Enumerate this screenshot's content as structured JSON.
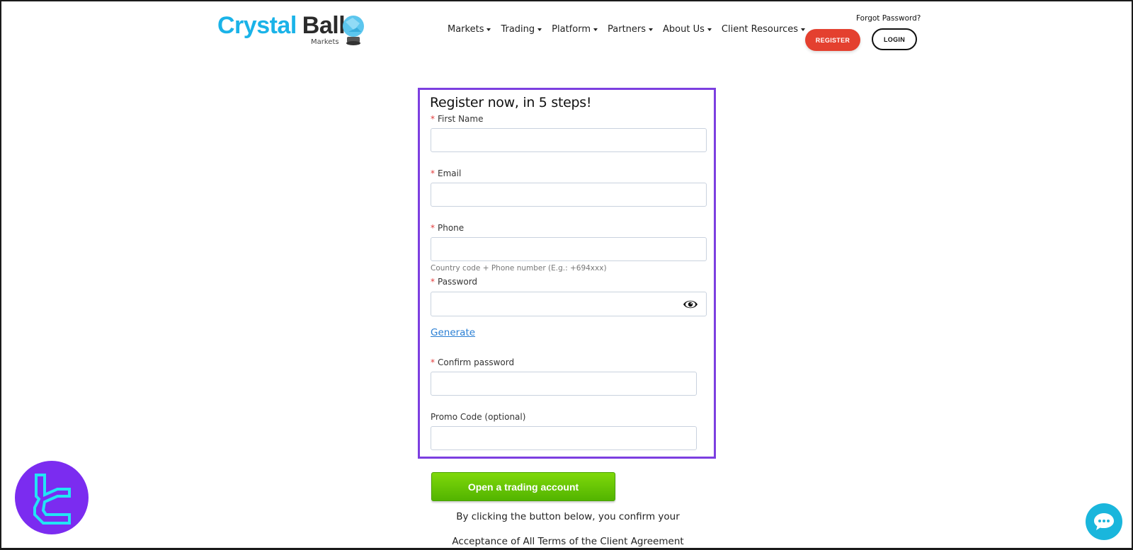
{
  "header": {
    "logo": {
      "brand_primary": "Crystal",
      "brand_secondary": "Ball",
      "subtitle": "Markets",
      "brand_color": "#1ab3e8"
    },
    "nav": [
      {
        "label": "Markets"
      },
      {
        "label": "Trading"
      },
      {
        "label": "Platform"
      },
      {
        "label": "Partners"
      },
      {
        "label": "About Us"
      },
      {
        "label": "Client Resources"
      }
    ],
    "forgot_password": "Forgot Password?",
    "register_label": "REGISTER",
    "login_label": "LOGIN",
    "register_color": "#e4402f"
  },
  "form": {
    "title": "Register now, in 5 steps!",
    "required_marker": "*",
    "fields": {
      "first_name": {
        "label": "First Name",
        "value": "",
        "required": true
      },
      "email": {
        "label": "Email",
        "value": "",
        "required": true
      },
      "phone": {
        "label": "Phone",
        "value": "",
        "required": true,
        "hint": "Country code + Phone number (E.g.: +694xxx)"
      },
      "password": {
        "label": "Password",
        "value": "",
        "required": true
      },
      "confirm_password": {
        "label": "Confirm password",
        "value": "",
        "required": true
      },
      "promo_code": {
        "label": "Promo Code (optional)",
        "value": "",
        "required": false
      }
    },
    "generate_label": "Generate",
    "highlight_color": "#7c3fe0"
  },
  "submit_label": "Open a trading account",
  "terms": {
    "line1": "By clicking the button below, you confirm your",
    "line2": "Acceptance of All Terms of the Client Agreement"
  },
  "widgets": {
    "chat_icon": "chat-bubble-icon",
    "watermark_icon": "tl-logo-icon"
  }
}
